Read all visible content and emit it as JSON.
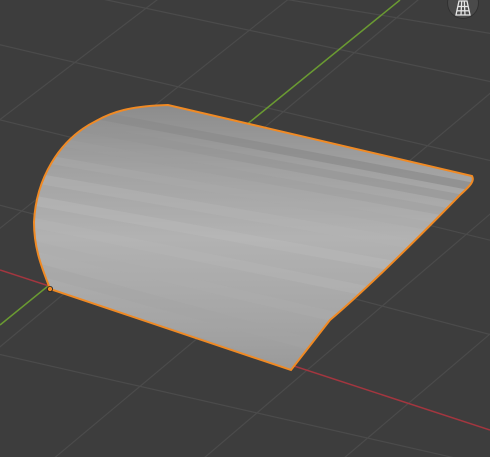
{
  "viewport": {
    "background": "#3d3d3d",
    "grid_color": "#4b4b4b",
    "x_axis_color": "#a3363f",
    "y_axis_color": "#6a9a32"
  },
  "object": {
    "selection_outline_color": "#f08a24",
    "origin_color": "#f08a24"
  },
  "overlay": {
    "gizmo_icon": "grid-perspective-icon"
  }
}
